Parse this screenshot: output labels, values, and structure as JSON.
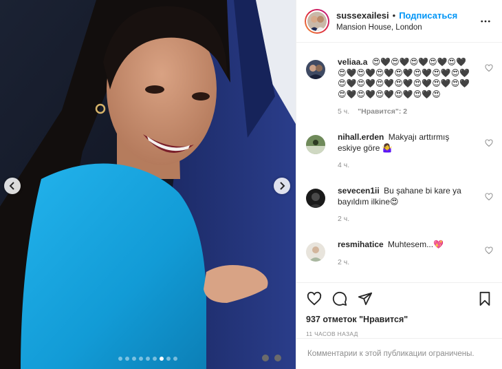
{
  "post": {
    "username": "sussexailesi",
    "follow_separator": "•",
    "follow_label": "Подписаться",
    "location": "Mansion House, London",
    "more_icon": "more-horizontal-icon"
  },
  "carousel": {
    "total_slides": 9,
    "active_slide": 7
  },
  "comments": [
    {
      "user": "veliaa.a",
      "text": "😍🖤😍🖤😍🖤😍🖤😍🖤😍🖤😍🖤😍🖤😍🖤😍🖤😍🖤😍🖤😍🖤😍🖤😍🖤😍🖤😍🖤😍🖤😍🖤😍🖤😍🖤😍🖤😍🖤😍🖤😍",
      "time": "5 ч.",
      "likes": "\"Нравится\": 2"
    },
    {
      "user": "nihall.erden",
      "text": "Makyajı arttırmış eskiye göre 🤷‍♀️",
      "time": "4 ч."
    },
    {
      "user": "sevecen1ii",
      "text": "Bu şahane bi kare ya bayıldım ilkine😍",
      "time": "2 ч."
    },
    {
      "user": "resmihatice",
      "text": "Muhtesem...💖",
      "time": "2 ч."
    }
  ],
  "actions": {
    "likes_label": "937 отметок \"Нравится\"",
    "timestamp": "11 часов назад"
  },
  "footer": {
    "comments_limited": "Комментарии к этой публикации ограничены."
  },
  "colors": {
    "accent": "#0095f6",
    "muted": "#8e8e8e",
    "border": "#efefef",
    "dress": "#1aa3dc"
  }
}
